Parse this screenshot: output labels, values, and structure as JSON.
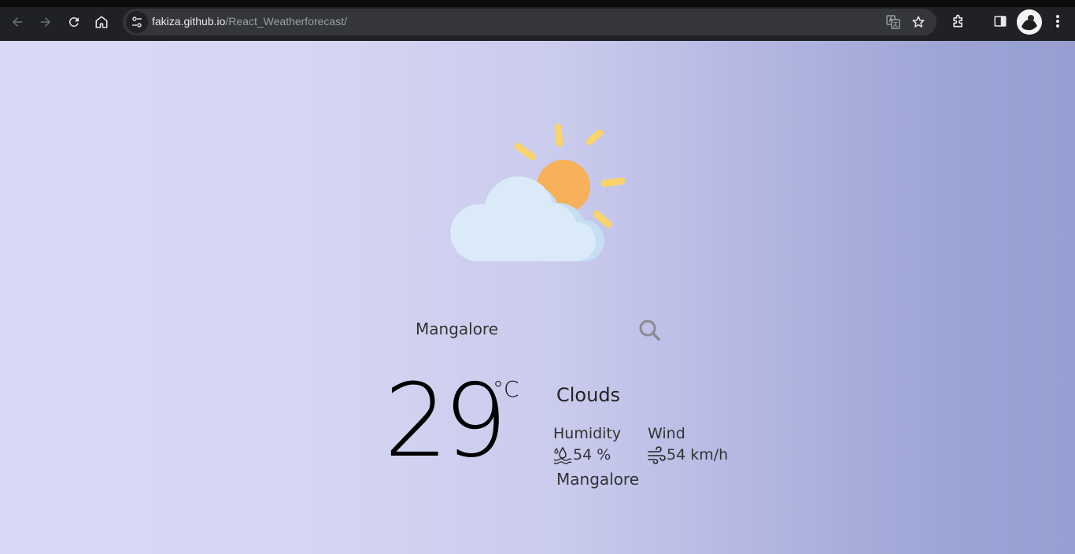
{
  "browser": {
    "url_host": "fakiza.github.io",
    "url_path": "/React_Weatherforecast/"
  },
  "weather": {
    "search": {
      "value": "Mangalore"
    },
    "temperature": "29",
    "unit": "°C",
    "condition": "Clouds",
    "humidity_label": "Humidity",
    "humidity_value": "54 %",
    "wind_label": "Wind",
    "wind_value": "54 km/h",
    "city": "Mangalore",
    "icon": "partly-cloudy-icon"
  },
  "colors": {
    "sun": "#f6b15a",
    "ray": "#f9d36b",
    "cloud": "#dbeaf9",
    "cloud_shadow": "#c3dcf3"
  }
}
